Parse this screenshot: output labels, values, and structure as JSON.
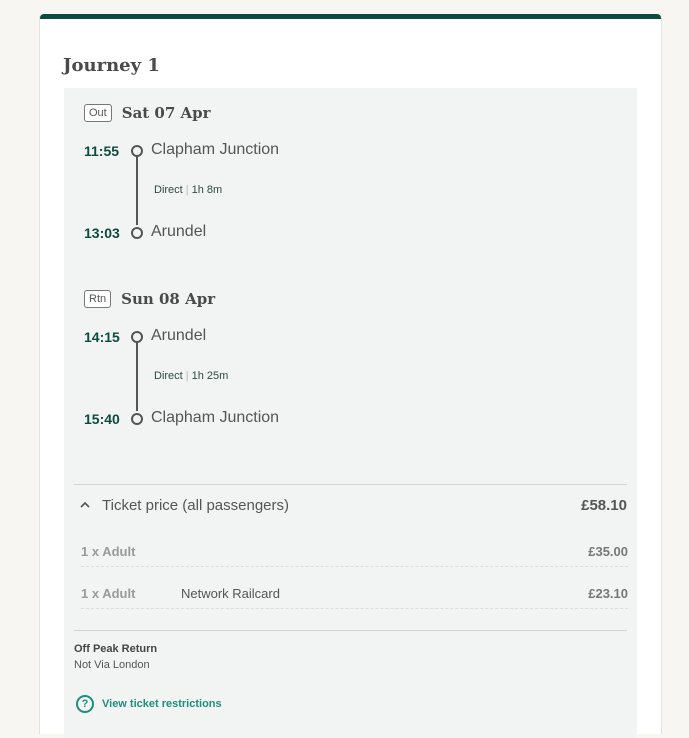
{
  "journey": {
    "title": "Journey 1"
  },
  "legs": [
    {
      "badge": "Out",
      "date": "Sat 07 Apr",
      "depart_time": "11:55",
      "depart_station": "Clapham Junction",
      "type": "Direct",
      "duration": "1h 8m",
      "arrive_time": "13:03",
      "arrive_station": "Arundel"
    },
    {
      "badge": "Rtn",
      "date": "Sun 08 Apr",
      "depart_time": "14:15",
      "depart_station": "Arundel",
      "type": "Direct",
      "duration": "1h 25m",
      "arrive_time": "15:40",
      "arrive_station": "Clapham Junction"
    }
  ],
  "price": {
    "label": "Ticket price (all passengers)",
    "total": "£58.10",
    "chevron_icon": "chevron-up-icon",
    "passengers": [
      {
        "qty": "1 x Adult",
        "railcard": "",
        "amount": "£35.00"
      },
      {
        "qty": "1 x Adult",
        "railcard": "Network Railcard",
        "amount": "£23.10"
      }
    ]
  },
  "ticket": {
    "type": "Off Peak Return",
    "route": "Not Via London"
  },
  "restrictions": {
    "label": "View ticket restrictions",
    "icon": "question-circle-icon"
  },
  "colors": {
    "brand": "#0d4b3e",
    "link": "#1e8f7a",
    "panel": "#f1f4f2"
  }
}
